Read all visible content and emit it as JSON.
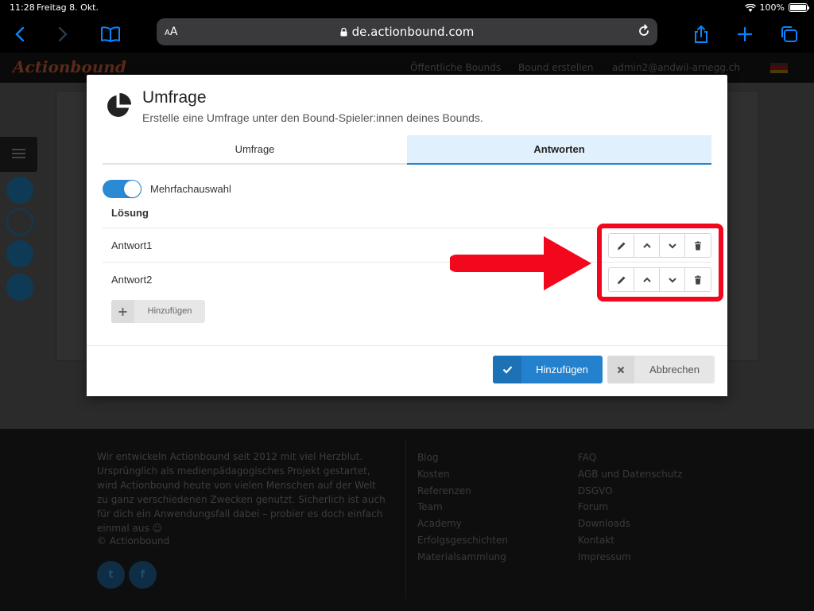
{
  "status_bar": {
    "time": "11:28",
    "date": "Freitag 8. Okt.",
    "battery": "100%"
  },
  "browser": {
    "url": "de.actionbound.com",
    "text_size_label": "AA"
  },
  "site": {
    "logo": "Actionbound",
    "nav": [
      "Öffentliche Bounds",
      "Bound erstellen",
      "admin2@andwil-arnegg.ch"
    ],
    "footer_text": "Wir entwickeln Actionbound seit 2012 mit viel Herzblut. Ursprünglich als medienpädagogisches Projekt gestartet, wird Actionbound heute von vielen Menschen auf der Welt zu ganz verschiedenen Zwecken genutzt. Sicherlich ist auch für dich ein Anwendungsfall dabei – probier es doch einfach einmal aus ☺",
    "copyright": "© Actionbound",
    "footer_col1": [
      "Blog",
      "Kosten",
      "Referenzen",
      "Team",
      "Academy",
      "Erfolgsgeschichten",
      "Materialsammlung"
    ],
    "footer_col2": [
      "FAQ",
      "AGB und Datenschutz",
      "DSGVO",
      "Forum",
      "Downloads",
      "Kontakt",
      "Impressum"
    ],
    "social": [
      "t",
      "f"
    ]
  },
  "modal": {
    "title": "Umfrage",
    "subtitle": "Erstelle eine Umfrage unter den Bound-Spieler:innen deines Bounds.",
    "tabs": [
      {
        "label": "Umfrage",
        "active": false
      },
      {
        "label": "Antworten",
        "active": true
      }
    ],
    "multiple_choice": {
      "label": "Mehrfachauswahl",
      "enabled": true
    },
    "column_header": "Lösung",
    "answers": [
      {
        "label": "Antwort1"
      },
      {
        "label": "Antwort2"
      }
    ],
    "add_label": "Hinzufügen",
    "submit_label": "Hinzufügen",
    "cancel_label": "Abbrechen"
  },
  "colors": {
    "primary": "#2381cd",
    "tab_active_bg": "#e0f0fc",
    "annotation_red": "#f3071c",
    "toggle_on": "#2b8ad4"
  }
}
